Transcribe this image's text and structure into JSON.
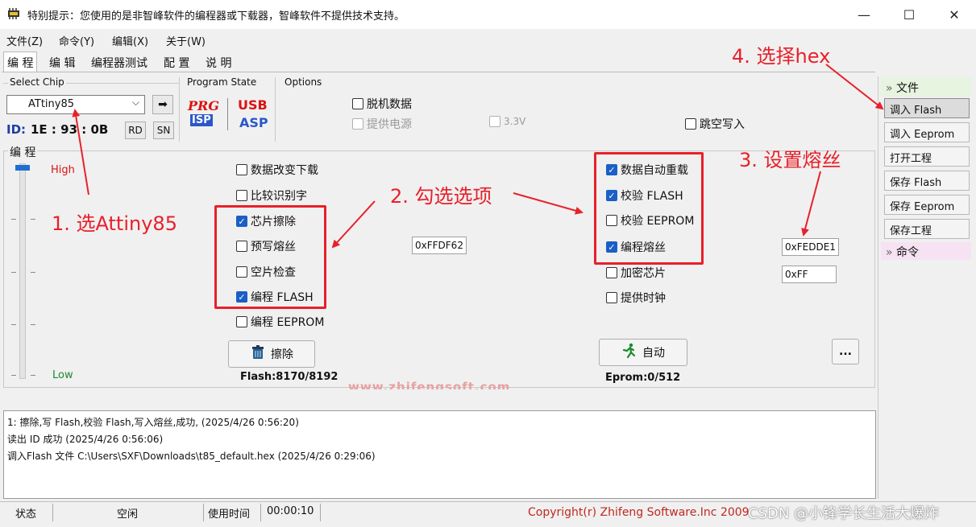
{
  "window": {
    "title": "特别提示：您使用的是非智峰软件的编程器或下载器，智峰软件不提供技术支持。",
    "min_glyph": "—",
    "max_glyph": "☐",
    "close_glyph": "✕"
  },
  "menu": [
    "文件(Z)",
    "命令(Y)",
    "编辑(X)",
    "关于(W)"
  ],
  "tabs": [
    "编 程",
    "编 辑",
    "编程器测试",
    "配 置",
    "说 明"
  ],
  "chip": {
    "group_label": "Select Chip",
    "selected": "ATtiny85",
    "go_glyph": "➡",
    "id_label": "ID:",
    "id_value": "1E : 93 : 0B",
    "rd_label": "RD",
    "sn_label": "SN"
  },
  "program_state": {
    "label": "Program State",
    "prg": "PRG",
    "isp": "ISP",
    "usb": "USB",
    "asp": "ASP"
  },
  "options": {
    "label": "Options",
    "offline": "脱机数据",
    "power": "提供电源",
    "v33": "3.3V",
    "skip_blank": "跳空写入"
  },
  "program": {
    "label": "编 程",
    "high": "High",
    "low": "Low",
    "checks_left": [
      {
        "text": "数据改变下载",
        "checked": false
      },
      {
        "text": "比较识别字",
        "checked": false
      },
      {
        "text": "芯片擦除",
        "checked": true
      },
      {
        "text": "预写熔丝",
        "checked": false
      },
      {
        "text": "空片检查",
        "checked": false
      },
      {
        "text": "编程 FLASH",
        "checked": true
      },
      {
        "text": "编程 EEPROM",
        "checked": false
      }
    ],
    "checks_right": [
      {
        "text": "数据自动重载",
        "checked": true
      },
      {
        "text": "校验 FLASH",
        "checked": true
      },
      {
        "text": "校验 EEPROM",
        "checked": false
      },
      {
        "text": "编程熔丝",
        "checked": true
      },
      {
        "text": "加密芯片",
        "checked": false
      },
      {
        "text": "提供时钟",
        "checked": false
      }
    ],
    "fuse_mid": "0xFFDF62",
    "fuse_right1": "0xFEDDE1",
    "fuse_right2": "0xFF",
    "erase_btn": "擦除",
    "auto_btn": "自动",
    "more_btn": "...",
    "flash_count": "Flash:8170/8192",
    "eprom_count": "Eprom:0/512",
    "bg_watermark": "www.zhifengsoft.com"
  },
  "log": [
    "1: 擦除,写 Flash,校验 Flash,写入熔丝,成功, (2025/4/26 0:56:20)",
    "读出 ID 成功 (2025/4/26 0:56:06)",
    "调入Flash 文件 C:\\Users\\SXF\\Downloads\\t85_default.hex (2025/4/26 0:29:06)"
  ],
  "status": {
    "label": "状态",
    "state": "空闲",
    "time_label": "使用时间",
    "time_value": "00:00:10",
    "copyright": "Copyright(r) Zhifeng Software.Inc 2009",
    "watermark": "CSDN @小锋学长生活大爆炸"
  },
  "right_panel": {
    "file_header": "文件",
    "buttons": [
      "调入 Flash",
      "调入 Eeprom",
      "打开工程",
      "保存 Flash",
      "保存 Eeprom",
      "保存工程"
    ],
    "cmd_header": "命令"
  },
  "annotations": {
    "step1": "1. 选Attiny85",
    "step2": "2. 勾选选项",
    "step3": "3. 设置熔丝",
    "step4": "4. 选择hex",
    "color": "#e8202a"
  }
}
